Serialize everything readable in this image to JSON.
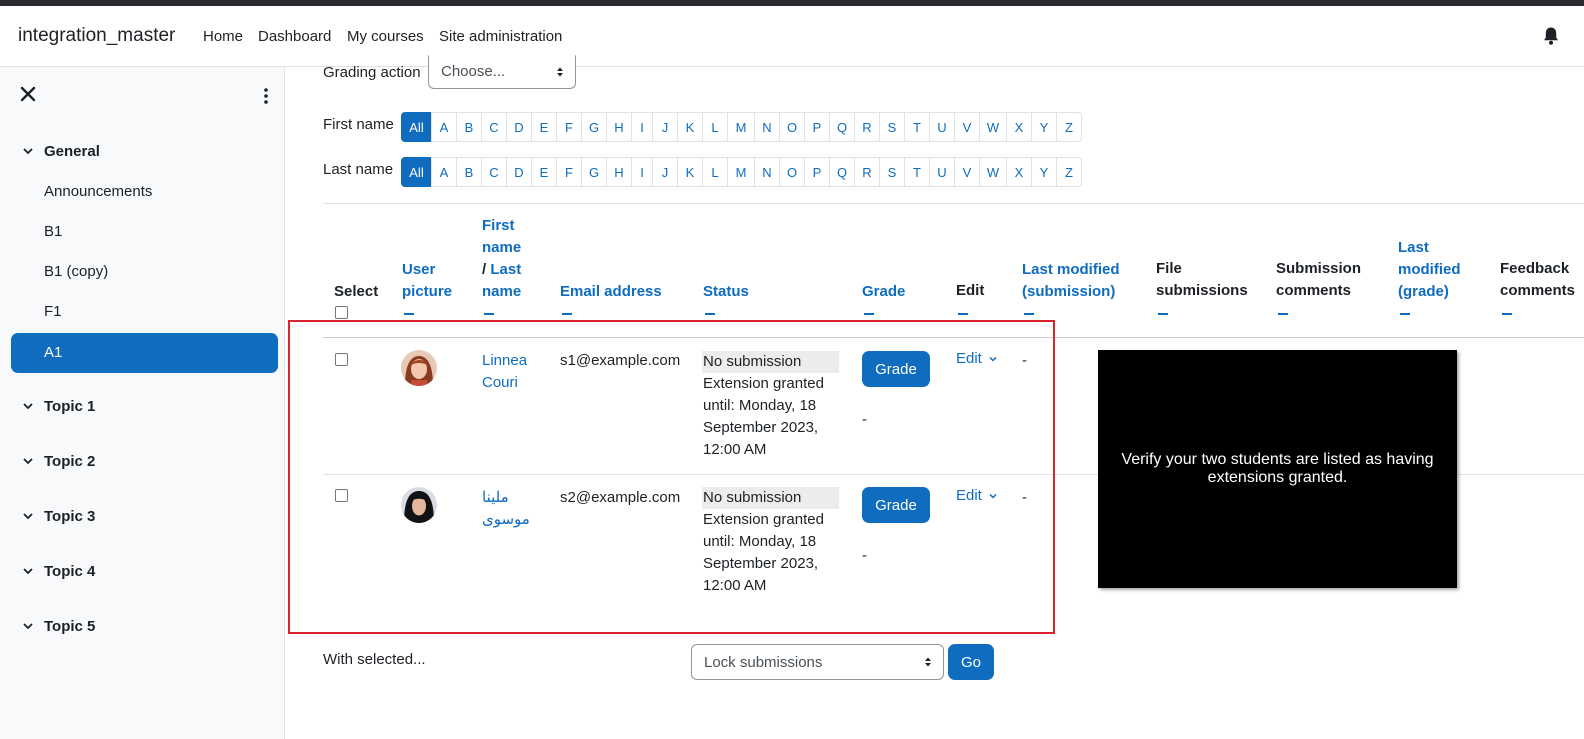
{
  "navbar": {
    "brand": "integration_master",
    "links": [
      "Home",
      "Dashboard",
      "My courses",
      "Site administration"
    ]
  },
  "drawer": {
    "sections": [
      {
        "label": "General",
        "items": [
          "Announcements",
          "B1",
          "B1 (copy)",
          "F1",
          "A1"
        ]
      },
      {
        "label": "Topic 1"
      },
      {
        "label": "Topic 2"
      },
      {
        "label": "Topic 3"
      },
      {
        "label": "Topic 4"
      },
      {
        "label": "Topic 5"
      }
    ],
    "active_item": "A1"
  },
  "grading_action": {
    "label": "Grading action",
    "value": "Choose..."
  },
  "filters": {
    "first_name_label": "First name",
    "last_name_label": "Last name",
    "letters": [
      "All",
      "A",
      "B",
      "C",
      "D",
      "E",
      "F",
      "G",
      "H",
      "I",
      "J",
      "K",
      "L",
      "M",
      "N",
      "O",
      "P",
      "Q",
      "R",
      "S",
      "T",
      "U",
      "V",
      "W",
      "X",
      "Y",
      "Z"
    ],
    "selected": "All"
  },
  "table": {
    "headers": {
      "select": "Select",
      "user_picture": [
        "User",
        "picture"
      ],
      "first_name": [
        "First",
        "name"
      ],
      "last_name_sep": "/",
      "last_name": [
        "Last",
        "name"
      ],
      "email": "Email address",
      "status": "Status",
      "grade": "Grade",
      "edit": "Edit",
      "last_modified_submission": [
        "Last modified",
        "(submission)"
      ],
      "file_submissions": [
        "File",
        "submissions"
      ],
      "submission_comments": [
        "Submission",
        "comments"
      ],
      "last_modified_grade": [
        "Last",
        "modified",
        "(grade)"
      ],
      "feedback_comments": [
        "Feedback",
        "comments"
      ]
    },
    "rows": [
      {
        "name": [
          "Linnea",
          "Couri"
        ],
        "email": "s1@example.com",
        "status": "No submission",
        "extension": [
          "Extension granted",
          "until: Monday, 18",
          "September 2023,",
          "12:00 AM"
        ],
        "grade_button": "Grade",
        "grade_value": "-",
        "edit": "Edit",
        "last_modified": "-"
      },
      {
        "name": [
          "ملینا",
          "موسوی"
        ],
        "email": "s2@example.com",
        "status": "No submission",
        "extension": [
          "Extension granted",
          "until: Monday, 18",
          "September 2023,",
          "12:00 AM"
        ],
        "grade_button": "Grade",
        "grade_value": "-",
        "edit": "Edit",
        "last_modified": "-"
      }
    ]
  },
  "bulk": {
    "label": "With selected...",
    "select_value": "Lock submissions",
    "go": "Go"
  },
  "tooltip": {
    "text": "Verify your two students are listed as having extensions granted."
  },
  "colors": {
    "primary": "#0f6cbf",
    "highlight": "#d9232d",
    "drawer_bg": "#f8f9fa"
  }
}
